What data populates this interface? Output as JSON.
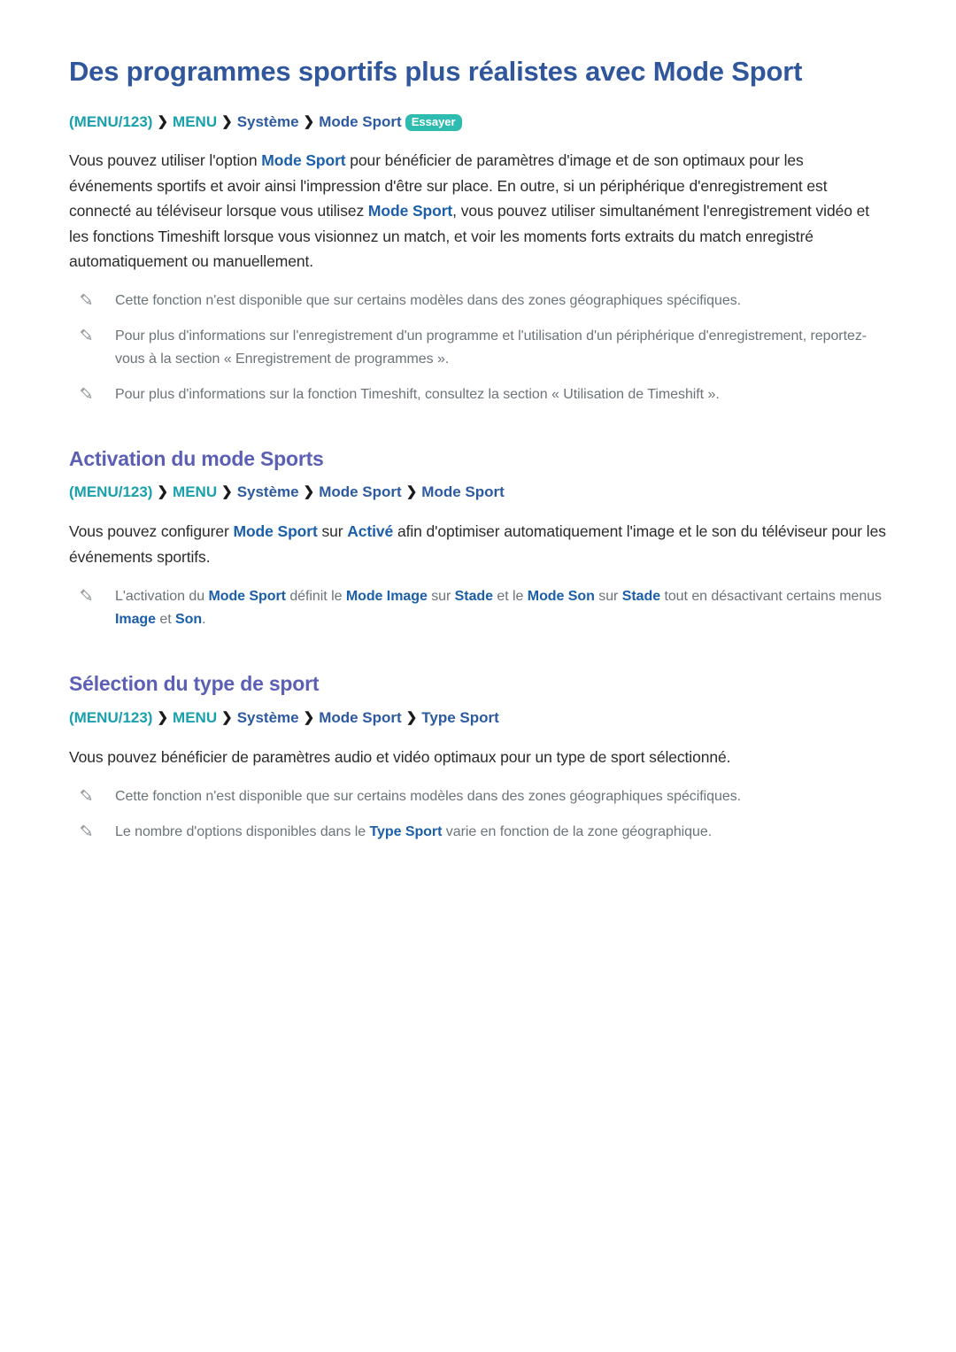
{
  "document": {
    "title": "Des programmes sportifs plus réalistes avec Mode Sport",
    "colors": {
      "title_blue": "#30569c",
      "heading_purple": "#5b60b4",
      "crumb_teal": "#19a0ad",
      "crumb_blue": "#2c5aa0",
      "keyword_blue": "#1b5faa",
      "badge_teal": "#2fbcb0",
      "note_gray": "#6b7479",
      "body_text": "#2b2b2b"
    }
  },
  "breadcrumb_main": {
    "item1": "(MENU/123)",
    "sep1": "❯",
    "item2": "MENU",
    "sep2": "❯",
    "item3": "Système",
    "sep3": "❯",
    "item4": "Mode Sport",
    "badge": "Essayer"
  },
  "intro_paragraph": {
    "t1": "Vous pouvez utiliser l'option ",
    "kw1": "Mode Sport",
    "t2": " pour bénéficier de paramètres d'image et de son optimaux pour les événements sportifs et avoir ainsi l'impression d'être sur place. En outre, si un périphérique d'enregistrement est connecté au téléviseur lorsque vous utilisez ",
    "kw2": "Mode Sport",
    "t3": ", vous pouvez utiliser simultanément l'enregistrement vidéo et les fonctions Timeshift lorsque vous visionnez un match, et voir les moments forts extraits du match enregistré automatiquement ou manuellement."
  },
  "intro_notes": {
    "note1": "Cette fonction n'est disponible que sur certains modèles dans des zones géographiques spécifiques.",
    "note2": "Pour plus d'informations sur l'enregistrement d'un programme et l'utilisation d'un périphérique d'enregistrement, reportez-vous à la section « Enregistrement de programmes ».",
    "note3": "Pour plus d'informations sur la fonction Timeshift, consultez la section « Utilisation de Timeshift »."
  },
  "section_activation": {
    "heading": "Activation du mode Sports",
    "breadcrumb": {
      "item1": "(MENU/123)",
      "sep1": "❯",
      "item2": "MENU",
      "sep2": "❯",
      "item3": "Système",
      "sep3": "❯",
      "item4": "Mode Sport",
      "sep4": "❯",
      "item5": "Mode Sport"
    },
    "paragraph": {
      "t1": "Vous pouvez configurer ",
      "kw1": "Mode Sport",
      "t2": " sur ",
      "kw2": "Activé",
      "t3": " afin d'optimiser automatiquement l'image et le son du téléviseur pour les événements sportifs."
    },
    "note": {
      "t1": "L'activation du ",
      "kw1": "Mode Sport",
      "t2": " définit le ",
      "kw2": "Mode Image",
      "t3": " sur ",
      "kw3": "Stade",
      "t4": " et le ",
      "kw4": "Mode Son",
      "t5": " sur ",
      "kw5": "Stade",
      "t6": " tout en désactivant certains menus ",
      "kw6": "Image",
      "t7": " et ",
      "kw7": "Son",
      "t8": "."
    }
  },
  "section_type": {
    "heading": "Sélection du type de sport",
    "breadcrumb": {
      "item1": "(MENU/123)",
      "sep1": "❯",
      "item2": "MENU",
      "sep2": "❯",
      "item3": "Système",
      "sep3": "❯",
      "item4": "Mode Sport",
      "sep4": "❯",
      "item5": "Type Sport"
    },
    "paragraph": "Vous pouvez bénéficier de paramètres audio et vidéo optimaux pour un type de sport sélectionné.",
    "note1": "Cette fonction n'est disponible que sur certains modèles dans des zones géographiques spécifiques.",
    "note2": {
      "t1": "Le nombre d'options disponibles dans le ",
      "kw1": "Type Sport",
      "t2": " varie en fonction de la zone géographique."
    }
  }
}
